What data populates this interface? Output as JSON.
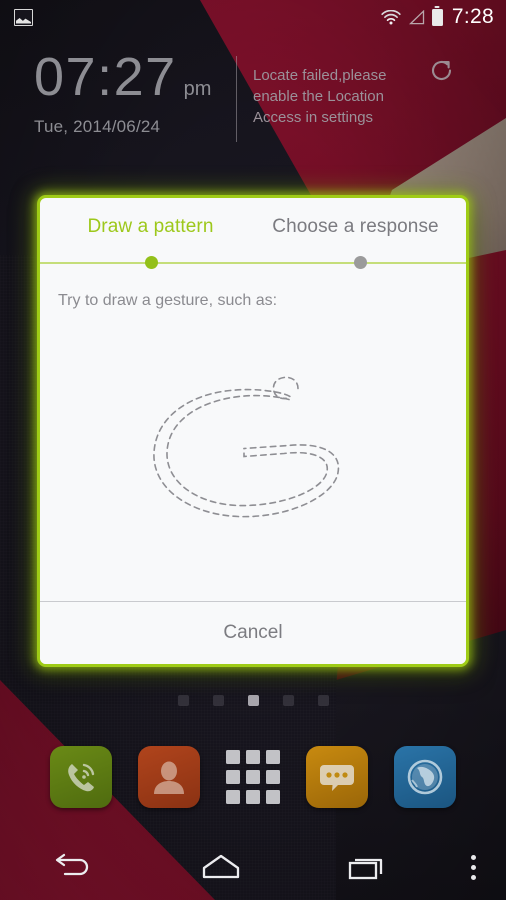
{
  "status_bar": {
    "notification_icon": "photo-icon",
    "wifi_icon": "wifi-icon",
    "signal_icon": "signal-triangle-icon",
    "battery_icon": "battery-icon",
    "clock": "7:28"
  },
  "clock_widget": {
    "time": "07:27",
    "ampm": "pm",
    "date": "Tue, 2014/06/24"
  },
  "weather_widget": {
    "message": "Locate failed,please enable the Location Access in settings",
    "refresh_icon": "refresh-icon"
  },
  "dialog": {
    "tabs": [
      {
        "label": "Draw a pattern",
        "active": true
      },
      {
        "label": "Choose a response",
        "active": false
      }
    ],
    "instruction": "Try to draw a gesture, such as:",
    "gesture_hint": "letter-g-gesture",
    "cancel_label": "Cancel",
    "accent_color": "#9fcc16",
    "active_tab_color": "#9dc81b",
    "inactive_tab_color": "#7b7b80",
    "background_color": "#f8f9fa"
  },
  "page_indicator": {
    "total": 5,
    "active_index": 2
  },
  "dock": {
    "items": [
      {
        "name": "phone",
        "icon": "phone-icon",
        "color": "#6a8a16"
      },
      {
        "name": "contacts",
        "icon": "person-icon",
        "color": "#b0441c"
      },
      {
        "name": "app-drawer",
        "icon": "grid-icon",
        "color": "transparent"
      },
      {
        "name": "messaging",
        "icon": "speech-bubble-icon",
        "color": "#c88a10"
      },
      {
        "name": "browser",
        "icon": "globe-icon",
        "color": "#2a74a8"
      }
    ]
  },
  "nav_bar": {
    "back": "back-arrow-icon",
    "home": "home-icon",
    "recents": "recents-icon",
    "menu": "overflow-menu-icon"
  }
}
